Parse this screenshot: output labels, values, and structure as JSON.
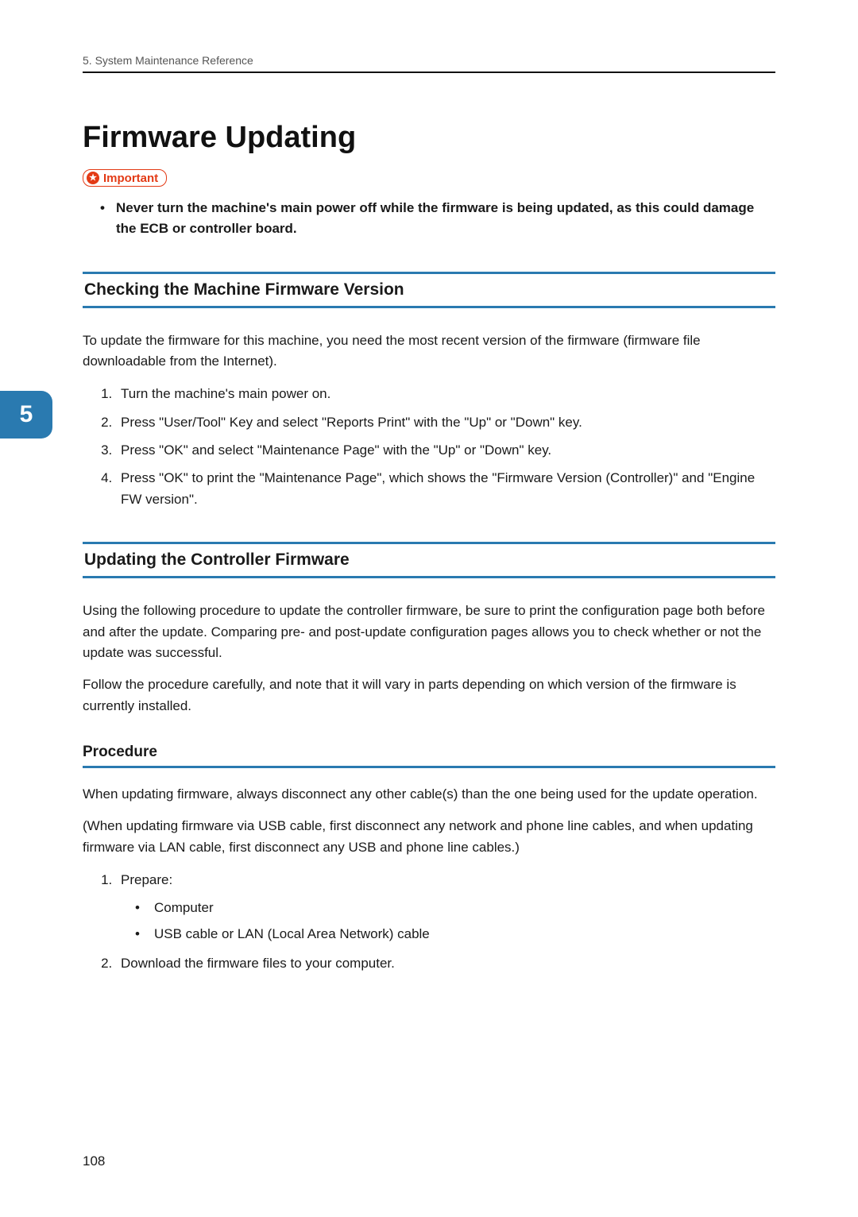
{
  "header": {
    "breadcrumb": "5. System Maintenance Reference"
  },
  "tab": {
    "chapter_number": "5"
  },
  "title": "Firmware Updating",
  "important": {
    "label": "Important",
    "bullets": [
      "Never turn the machine's main power off while the firmware is being updated, as this could damage the ECB or controller board."
    ]
  },
  "section_check": {
    "heading": "Checking the Machine Firmware Version",
    "intro": "To update the firmware for this machine, you need the most recent version of the firmware (firmware file downloadable from the Internet).",
    "steps": [
      "Turn the machine's main power on.",
      "Press \"User/Tool\" Key and select \"Reports Print\" with the \"Up\" or \"Down\" key.",
      "Press \"OK\" and select \"Maintenance Page\" with the \"Up\" or \"Down\" key.",
      "Press \"OK\" to print the \"Maintenance Page\", which shows the \"Firmware Version (Controller)\" and \"Engine FW version\"."
    ]
  },
  "section_update": {
    "heading": "Updating the Controller Firmware",
    "p1": "Using the following procedure to update the controller firmware, be sure to print the configuration page both before and after the update. Comparing pre- and post-update configuration pages allows you to check whether or not the update was successful.",
    "p2": "Follow the procedure carefully, and note that it will vary in parts depending on which version of the firmware is currently installed."
  },
  "section_procedure": {
    "heading": "Procedure",
    "p1": "When updating firmware, always disconnect any other cable(s) than the one being used for the update operation.",
    "p2": "(When updating firmware via USB cable, first disconnect any network and phone line cables, and when updating firmware via LAN cable, first disconnect any USB and phone line cables.)",
    "steps": {
      "s1": "Prepare:",
      "s1_items": [
        "Computer",
        "USB cable or LAN (Local Area Network) cable"
      ],
      "s2": "Download the firmware files to your computer."
    }
  },
  "footer": {
    "page_number": "108"
  }
}
